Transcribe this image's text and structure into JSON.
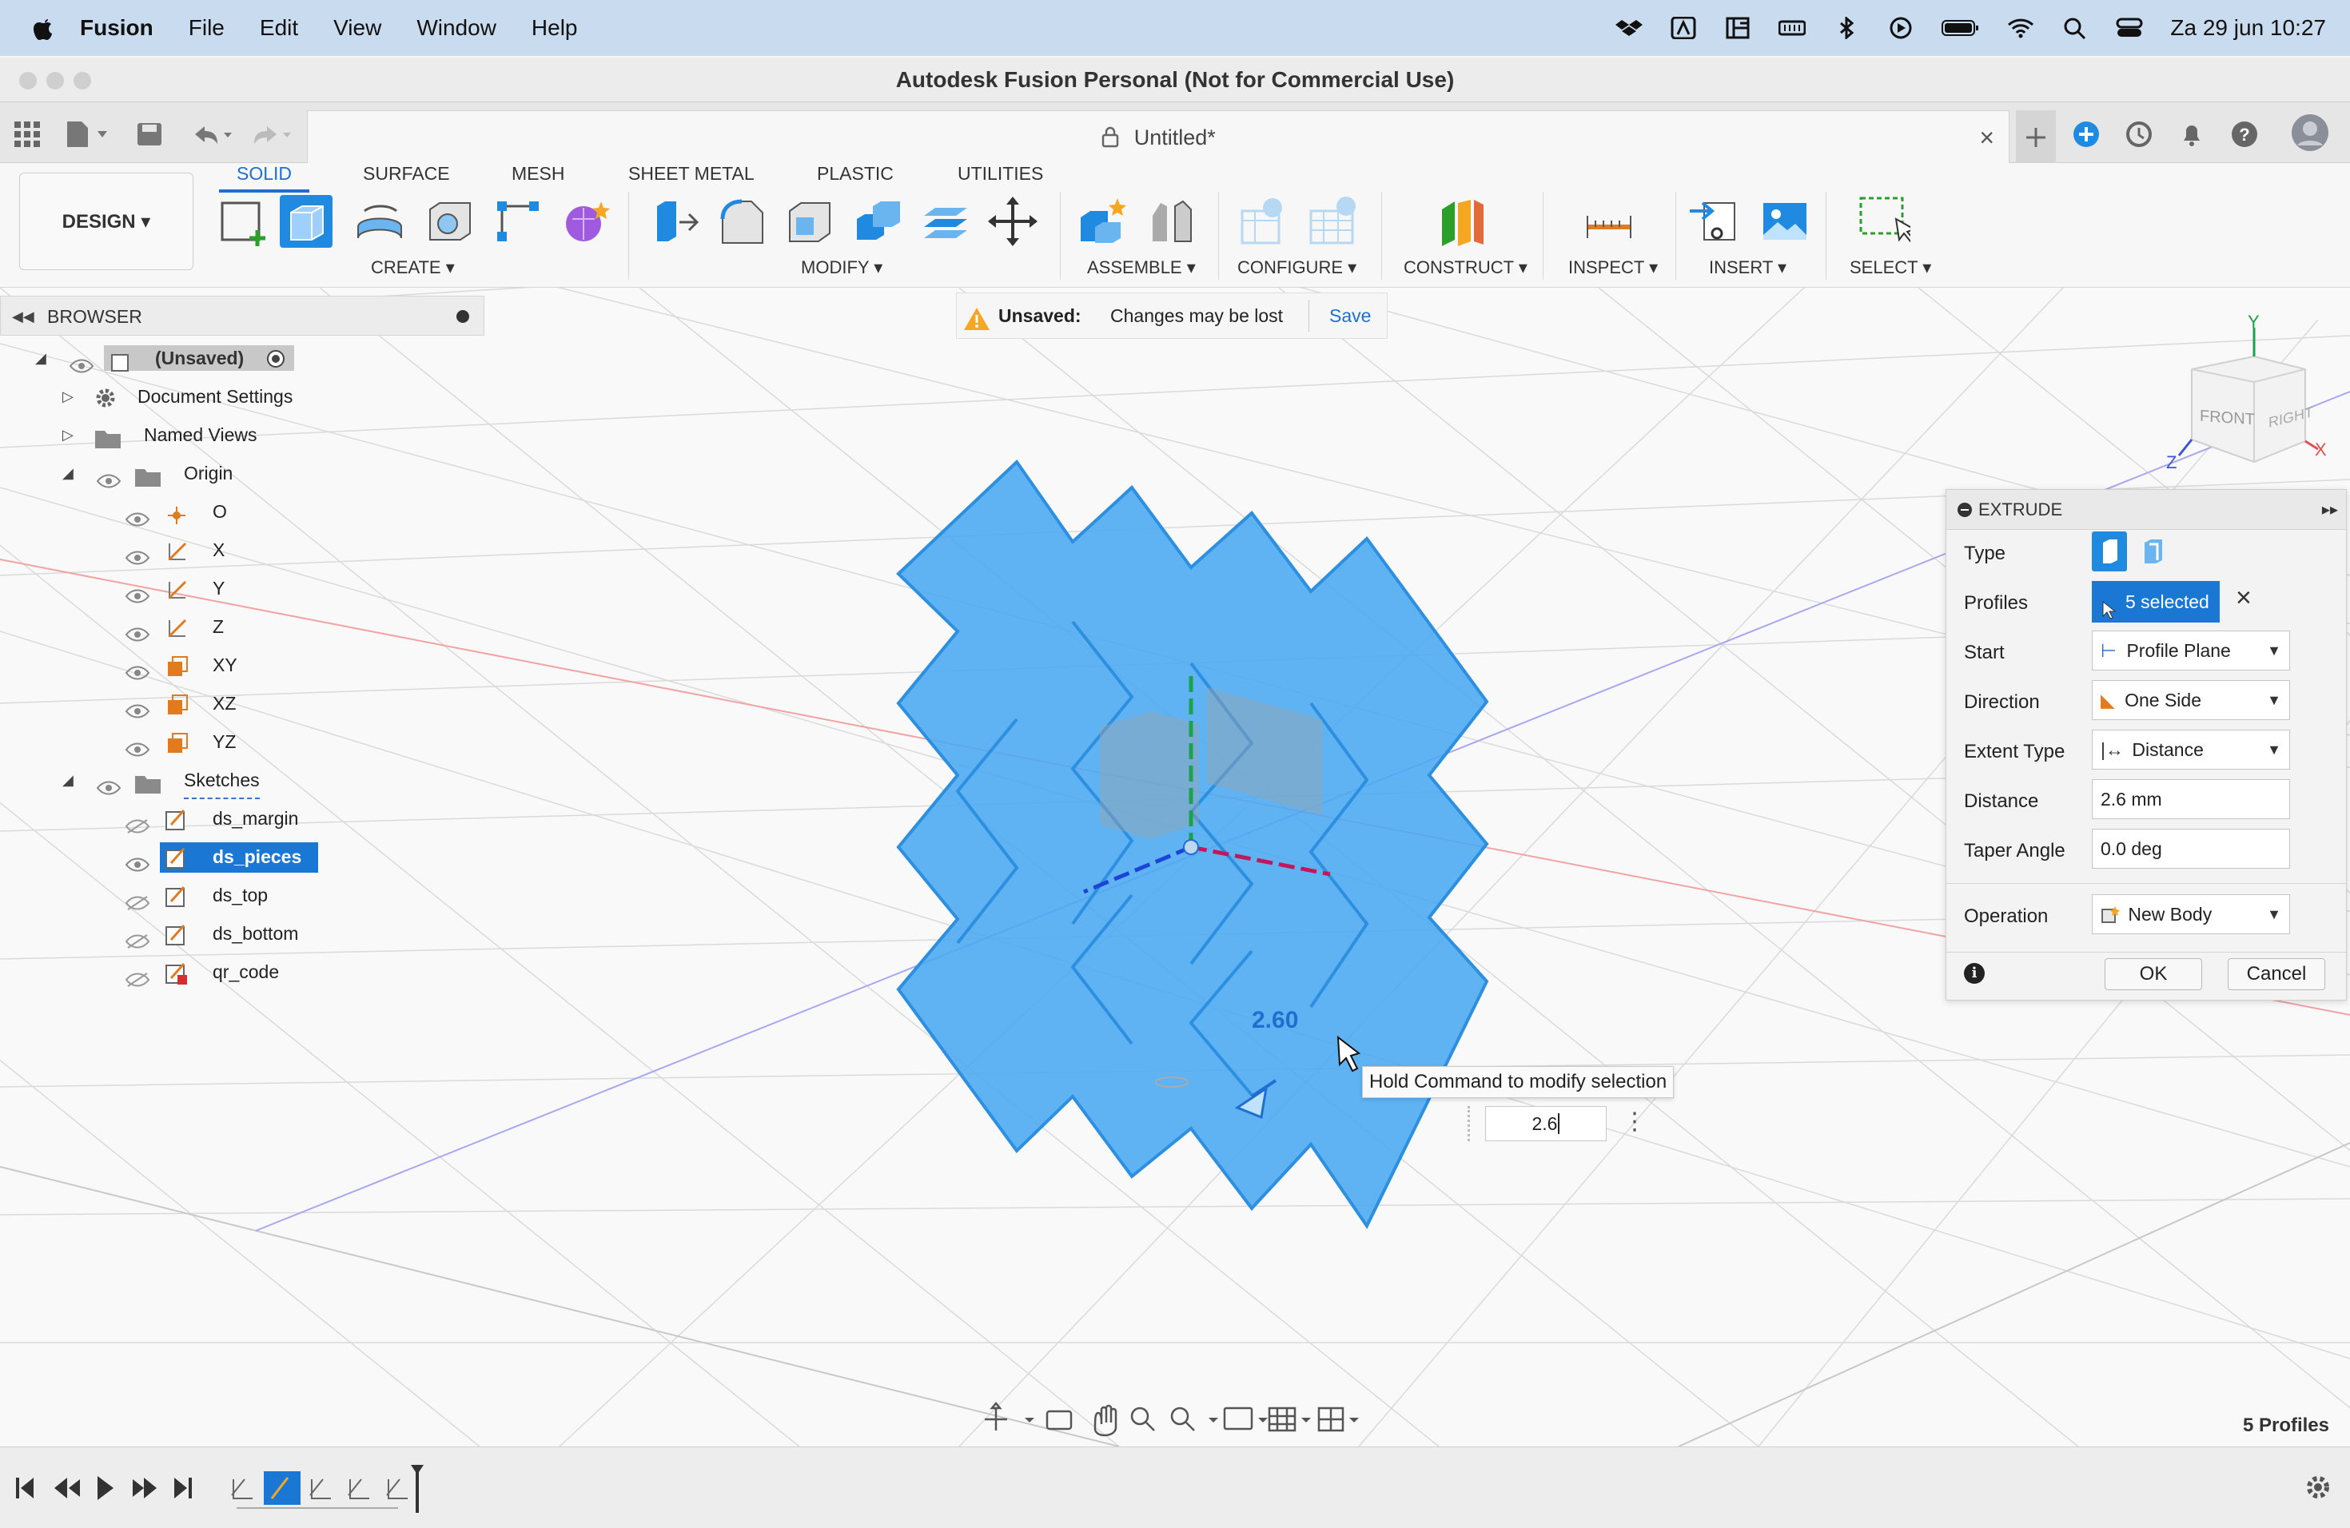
{
  "menubar": {
    "app_name": "Fusion",
    "items": [
      "File",
      "Edit",
      "View",
      "Window",
      "Help"
    ],
    "datetime": "Za 29 jun  10:27"
  },
  "window": {
    "title": "Autodesk Fusion Personal (Not for Commercial Use)"
  },
  "document_tab": {
    "label": "Untitled*"
  },
  "toolbar": {
    "workspace_label": "DESIGN",
    "tabs": [
      "SOLID",
      "SURFACE",
      "MESH",
      "SHEET METAL",
      "PLASTIC",
      "UTILITIES"
    ],
    "active_tab": "SOLID",
    "groups": [
      "CREATE",
      "MODIFY",
      "ASSEMBLE",
      "CONFIGURE",
      "CONSTRUCT",
      "INSPECT",
      "INSERT",
      "SELECT"
    ]
  },
  "browser": {
    "title": "BROWSER",
    "root": "(Unsaved)",
    "items": [
      {
        "label": "Document Settings"
      },
      {
        "label": "Named Views"
      },
      {
        "label": "Origin"
      },
      {
        "label": "O"
      },
      {
        "label": "X"
      },
      {
        "label": "Y"
      },
      {
        "label": "Z"
      },
      {
        "label": "XY"
      },
      {
        "label": "XZ"
      },
      {
        "label": "YZ"
      },
      {
        "label": "Sketches"
      },
      {
        "label": "ds_margin"
      },
      {
        "label": "ds_pieces"
      },
      {
        "label": "ds_top"
      },
      {
        "label": "ds_bottom"
      },
      {
        "label": "qr_code"
      }
    ],
    "selected_item": "ds_pieces"
  },
  "unsaved_bar": {
    "title": "Unsaved:",
    "message": "Changes may be lost",
    "action": "Save"
  },
  "viewcube": {
    "front": "FRONT",
    "right": "RIGHT",
    "axis_y": "Y",
    "axis_x": "X",
    "axis_z": "Z"
  },
  "extrude": {
    "title": "EXTRUDE",
    "type_label": "Type",
    "profiles_label": "Profiles",
    "profiles_value": "5 selected",
    "start_label": "Start",
    "start_value": "Profile Plane",
    "direction_label": "Direction",
    "direction_value": "One Side",
    "extent_label": "Extent Type",
    "extent_value": "Distance",
    "distance_label": "Distance",
    "distance_value": "2.6 mm",
    "taper_label": "Taper Angle",
    "taper_value": "0.0 deg",
    "operation_label": "Operation",
    "operation_value": "New Body",
    "ok_label": "OK",
    "cancel_label": "Cancel"
  },
  "viewport": {
    "dimension_label": "2.60",
    "tooltip": "Hold Command to modify selection",
    "distance_input": "2.6",
    "status": "5 Profiles"
  },
  "colors": {
    "accent": "#1f6fd0",
    "profile_fill": "#4aa8f0",
    "selected_bg": "#1a78d4"
  }
}
